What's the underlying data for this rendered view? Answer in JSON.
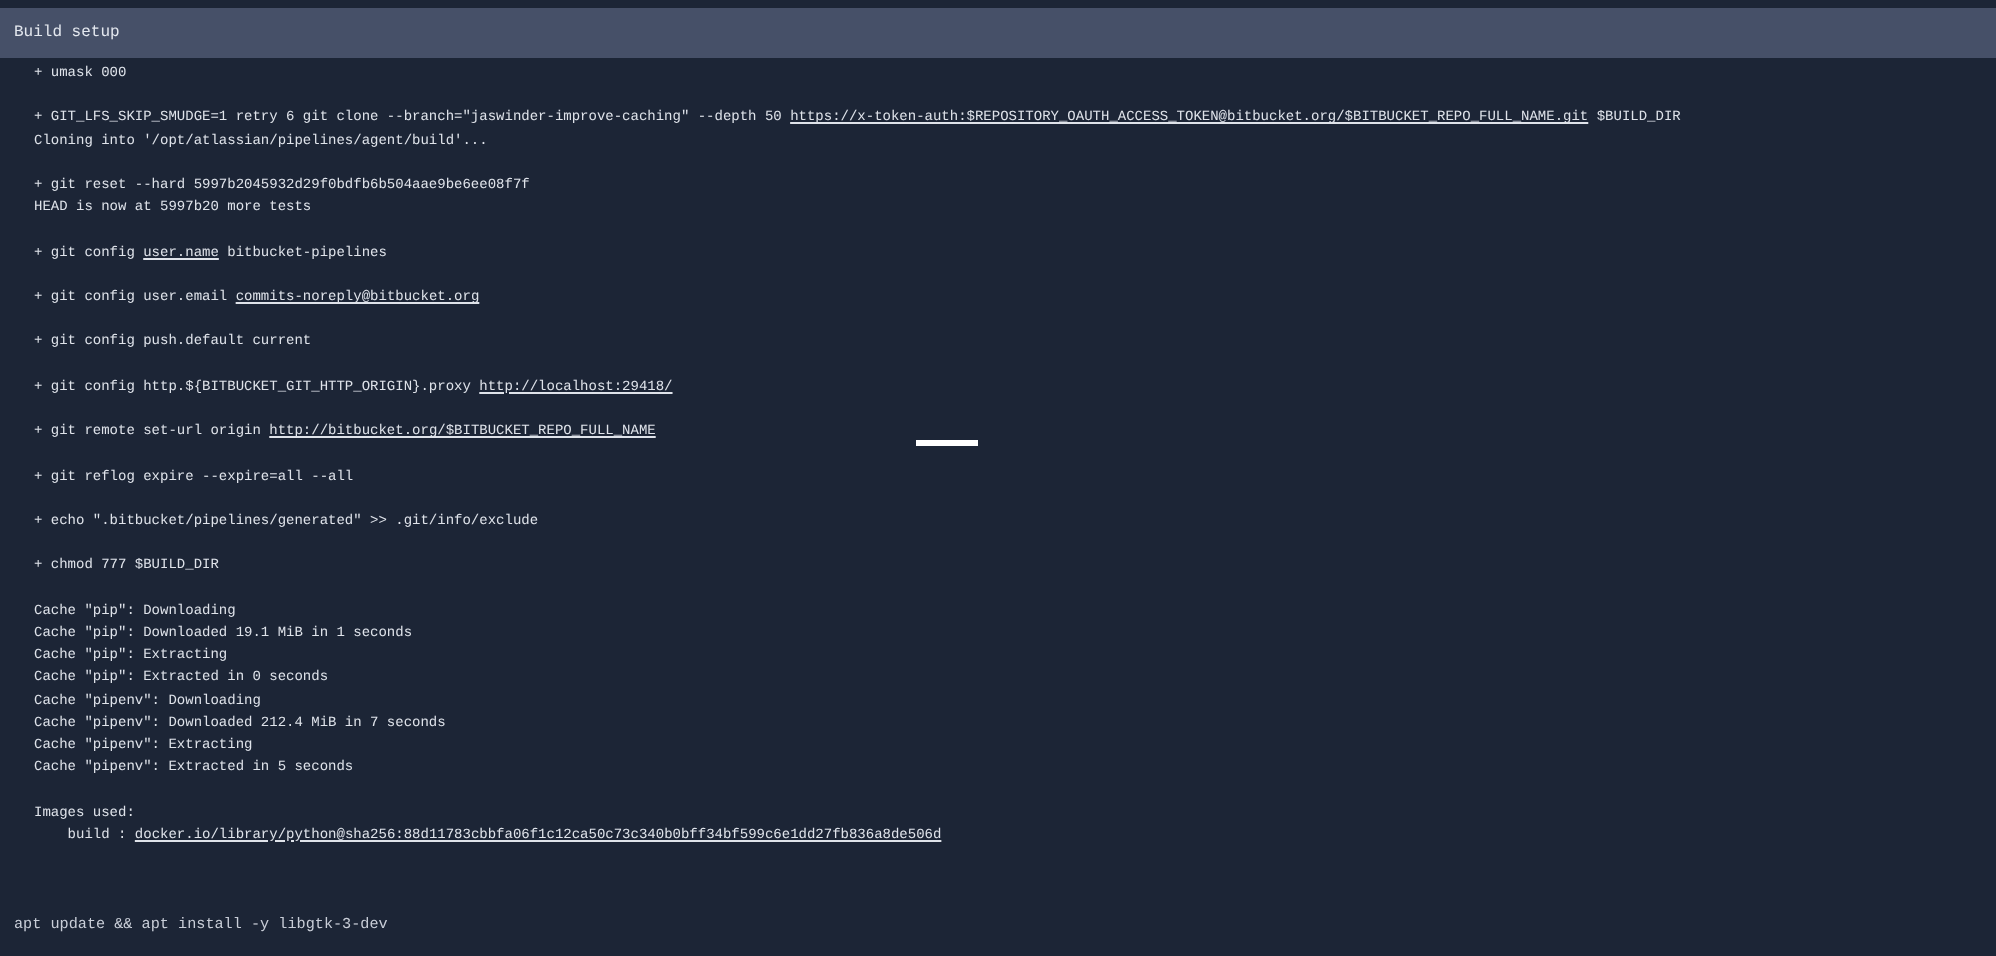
{
  "section": {
    "title": "Build setup"
  },
  "log_groups": [
    {
      "lines": [
        [
          {
            "text": "+ umask 000",
            "link": false
          }
        ]
      ]
    },
    {
      "lines": [
        [
          {
            "text": "+ GIT_LFS_SKIP_SMUDGE=1 retry 6 git clone --branch=\"jaswinder-improve-caching\" --depth 50 ",
            "link": false
          },
          {
            "text": "https://x-token-auth:$REPOSITORY_OAUTH_ACCESS_TOKEN@bitbucket.org/$BITBUCKET_REPO_FULL_NAME.git",
            "link": true
          },
          {
            "text": " $BUILD_DIR",
            "link": false
          }
        ],
        [
          {
            "text": "Cloning into '/opt/atlassian/pipelines/agent/build'...",
            "link": false
          }
        ]
      ]
    },
    {
      "lines": [
        [
          {
            "text": "+ git reset --hard 5997b2045932d29f0bdfb6b504aae9be6ee08f7f",
            "link": false
          }
        ],
        [
          {
            "text": "HEAD is now at 5997b20 more tests",
            "link": false
          }
        ]
      ]
    },
    {
      "lines": [
        [
          {
            "text": "+ git config ",
            "link": false
          },
          {
            "text": "user.name",
            "link": true
          },
          {
            "text": " bitbucket-pipelines",
            "link": false
          }
        ]
      ]
    },
    {
      "lines": [
        [
          {
            "text": "+ git config user.email ",
            "link": false
          },
          {
            "text": "commits-noreply@bitbucket.org",
            "link": true
          }
        ]
      ]
    },
    {
      "lines": [
        [
          {
            "text": "+ git config push.default current",
            "link": false
          }
        ]
      ]
    },
    {
      "lines": [
        [
          {
            "text": "+ git config http.${BITBUCKET_GIT_HTTP_ORIGIN}.proxy ",
            "link": false
          },
          {
            "text": "http://localhost:29418/",
            "link": true
          }
        ]
      ]
    },
    {
      "lines": [
        [
          {
            "text": "+ git remote set-url origin ",
            "link": false
          },
          {
            "text": "http://bitbucket.org/$BITBUCKET_REPO_FULL_NAME",
            "link": true
          }
        ]
      ]
    },
    {
      "lines": [
        [
          {
            "text": "+ git reflog expire --expire=all --all",
            "link": false
          }
        ]
      ]
    },
    {
      "lines": [
        [
          {
            "text": "+ echo \".bitbucket/pipelines/generated\" >> .git/info/exclude",
            "link": false
          }
        ]
      ]
    },
    {
      "lines": [
        [
          {
            "text": "+ chmod 777 $BUILD_DIR",
            "link": false
          }
        ]
      ]
    },
    {
      "lines": [
        [
          {
            "text": "Cache \"pip\": Downloading",
            "link": false
          }
        ],
        [
          {
            "text": "Cache \"pip\": Downloaded 19.1 MiB in 1 seconds",
            "link": false
          }
        ],
        [
          {
            "text": "Cache \"pip\": Extracting",
            "link": false
          }
        ],
        [
          {
            "text": "Cache \"pip\": Extracted in 0 seconds",
            "link": false
          }
        ],
        [
          {
            "text": "Cache \"pipenv\": Downloading",
            "link": false
          }
        ],
        [
          {
            "text": "Cache \"pipenv\": Downloaded 212.4 MiB in 7 seconds",
            "link": false
          }
        ],
        [
          {
            "text": "Cache \"pipenv\": Extracting",
            "link": false
          }
        ],
        [
          {
            "text": "Cache \"pipenv\": Extracted in 5 seconds",
            "link": false
          }
        ]
      ]
    },
    {
      "lines": [
        [
          {
            "text": "Images used:",
            "link": false
          }
        ],
        [
          {
            "text": "    build : ",
            "link": false
          },
          {
            "text": "docker.io/library/python@sha256:88d11783cbbfa06f1c12ca50c73c340b0bff34bf599c6e1dd27fb836a8de506d",
            "link": true
          }
        ]
      ]
    }
  ],
  "command": "apt update && apt install -y libgtk-3-dev"
}
